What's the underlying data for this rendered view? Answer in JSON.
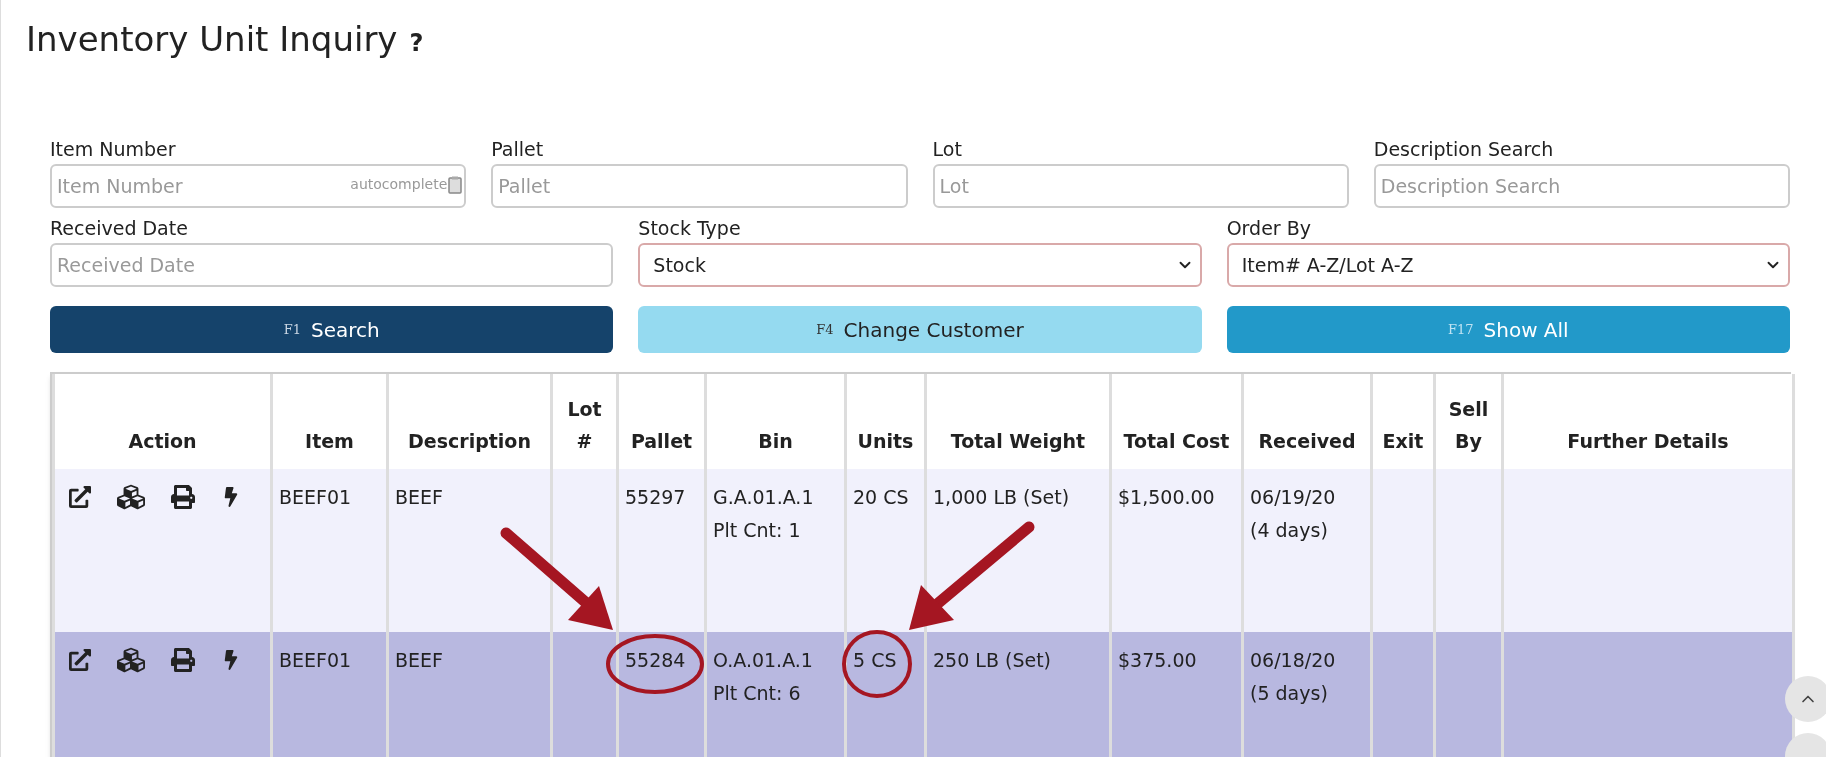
{
  "page": {
    "title": "Inventory Unit Inquiry",
    "help": "?"
  },
  "filters_top": [
    {
      "label": "Item Number",
      "placeholder": "Item Number",
      "hint": "autocomplete"
    },
    {
      "label": "Pallet",
      "placeholder": "Pallet"
    },
    {
      "label": "Lot",
      "placeholder": "Lot"
    },
    {
      "label": "Description Search",
      "placeholder": "Description Search"
    }
  ],
  "filters_bottom": [
    {
      "kind": "text",
      "label": "Received Date",
      "placeholder": "Received Date"
    },
    {
      "kind": "select",
      "label": "Stock Type",
      "value": "Stock"
    },
    {
      "kind": "select",
      "label": "Order By",
      "value": "Item# A-Z/Lot A-Z"
    }
  ],
  "buttons": [
    {
      "key": "F1",
      "label": "Search"
    },
    {
      "key": "F4",
      "label": "Change Customer"
    },
    {
      "key": "F17",
      "label": "Show All"
    }
  ],
  "table": {
    "columns": [
      "Action",
      "Item",
      "Description",
      "Lot #",
      "Pallet",
      "Bin",
      "Units",
      "Total Weight",
      "Total Cost",
      "Received",
      "Exit",
      "Sell By",
      "Further Details"
    ],
    "rows": [
      {
        "selected": false,
        "cells": [
          "",
          "BEEF01",
          "BEEF",
          "",
          "55297",
          [
            "G.A.01.A.1",
            "Plt Cnt: 1"
          ],
          "20 CS",
          "1,000 LB (Set)",
          "$1,500.00",
          [
            "06/19/20",
            "(4 days)"
          ],
          "",
          "",
          ""
        ]
      },
      {
        "selected": true,
        "cells": [
          "",
          "BEEF01",
          "BEEF",
          "",
          "55284",
          [
            "O.A.01.A.1",
            "Plt Cnt: 6"
          ],
          "5 CS",
          "250 LB (Set)",
          "$375.00",
          [
            "06/18/20",
            "(5 days)"
          ],
          "",
          "",
          ""
        ]
      }
    ]
  }
}
